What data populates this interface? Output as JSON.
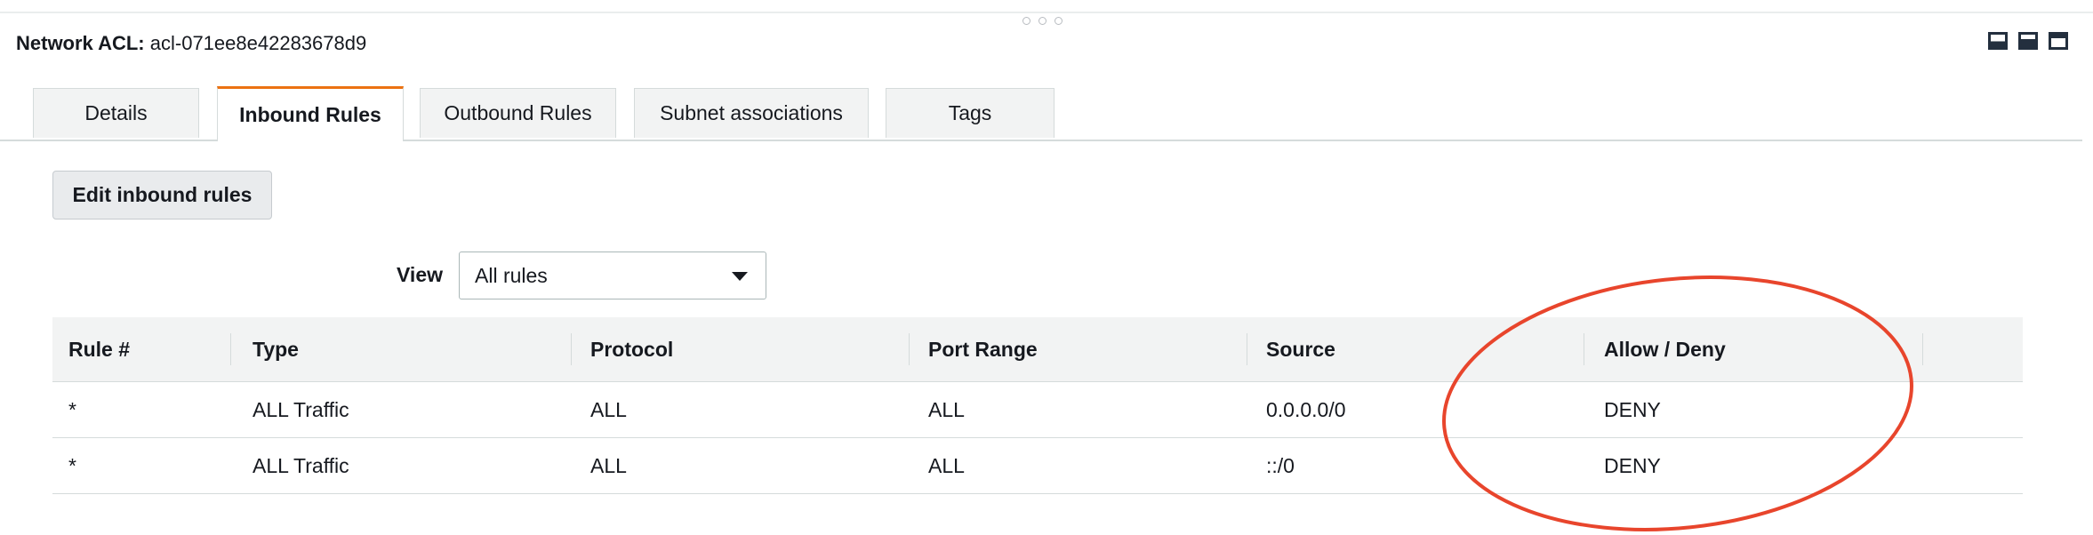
{
  "header": {
    "label": "Network ACL:",
    "acl_id": "acl-071ee8e42283678d9"
  },
  "layout_icons": [
    "layout-bottom-large-icon",
    "layout-split-icon",
    "layout-top-icon"
  ],
  "tabs": [
    {
      "label": "Details",
      "active": false
    },
    {
      "label": "Inbound Rules",
      "active": true
    },
    {
      "label": "Outbound Rules",
      "active": false
    },
    {
      "label": "Subnet associations",
      "active": false
    },
    {
      "label": "Tags",
      "active": false
    }
  ],
  "edit_button": "Edit inbound rules",
  "view": {
    "label": "View",
    "selected": "All rules"
  },
  "table": {
    "columns": [
      "Rule #",
      "Type",
      "Protocol",
      "Port Range",
      "Source",
      "Allow / Deny"
    ],
    "rows": [
      [
        "*",
        "ALL Traffic",
        "ALL",
        "ALL",
        "0.0.0.0/0",
        "DENY"
      ],
      [
        "*",
        "ALL Traffic",
        "ALL",
        "ALL",
        "::/0",
        "DENY"
      ]
    ]
  },
  "colors": {
    "active_tab_accent": "#ec7211",
    "deny": "#d13212",
    "annotation": "#e8452c"
  }
}
